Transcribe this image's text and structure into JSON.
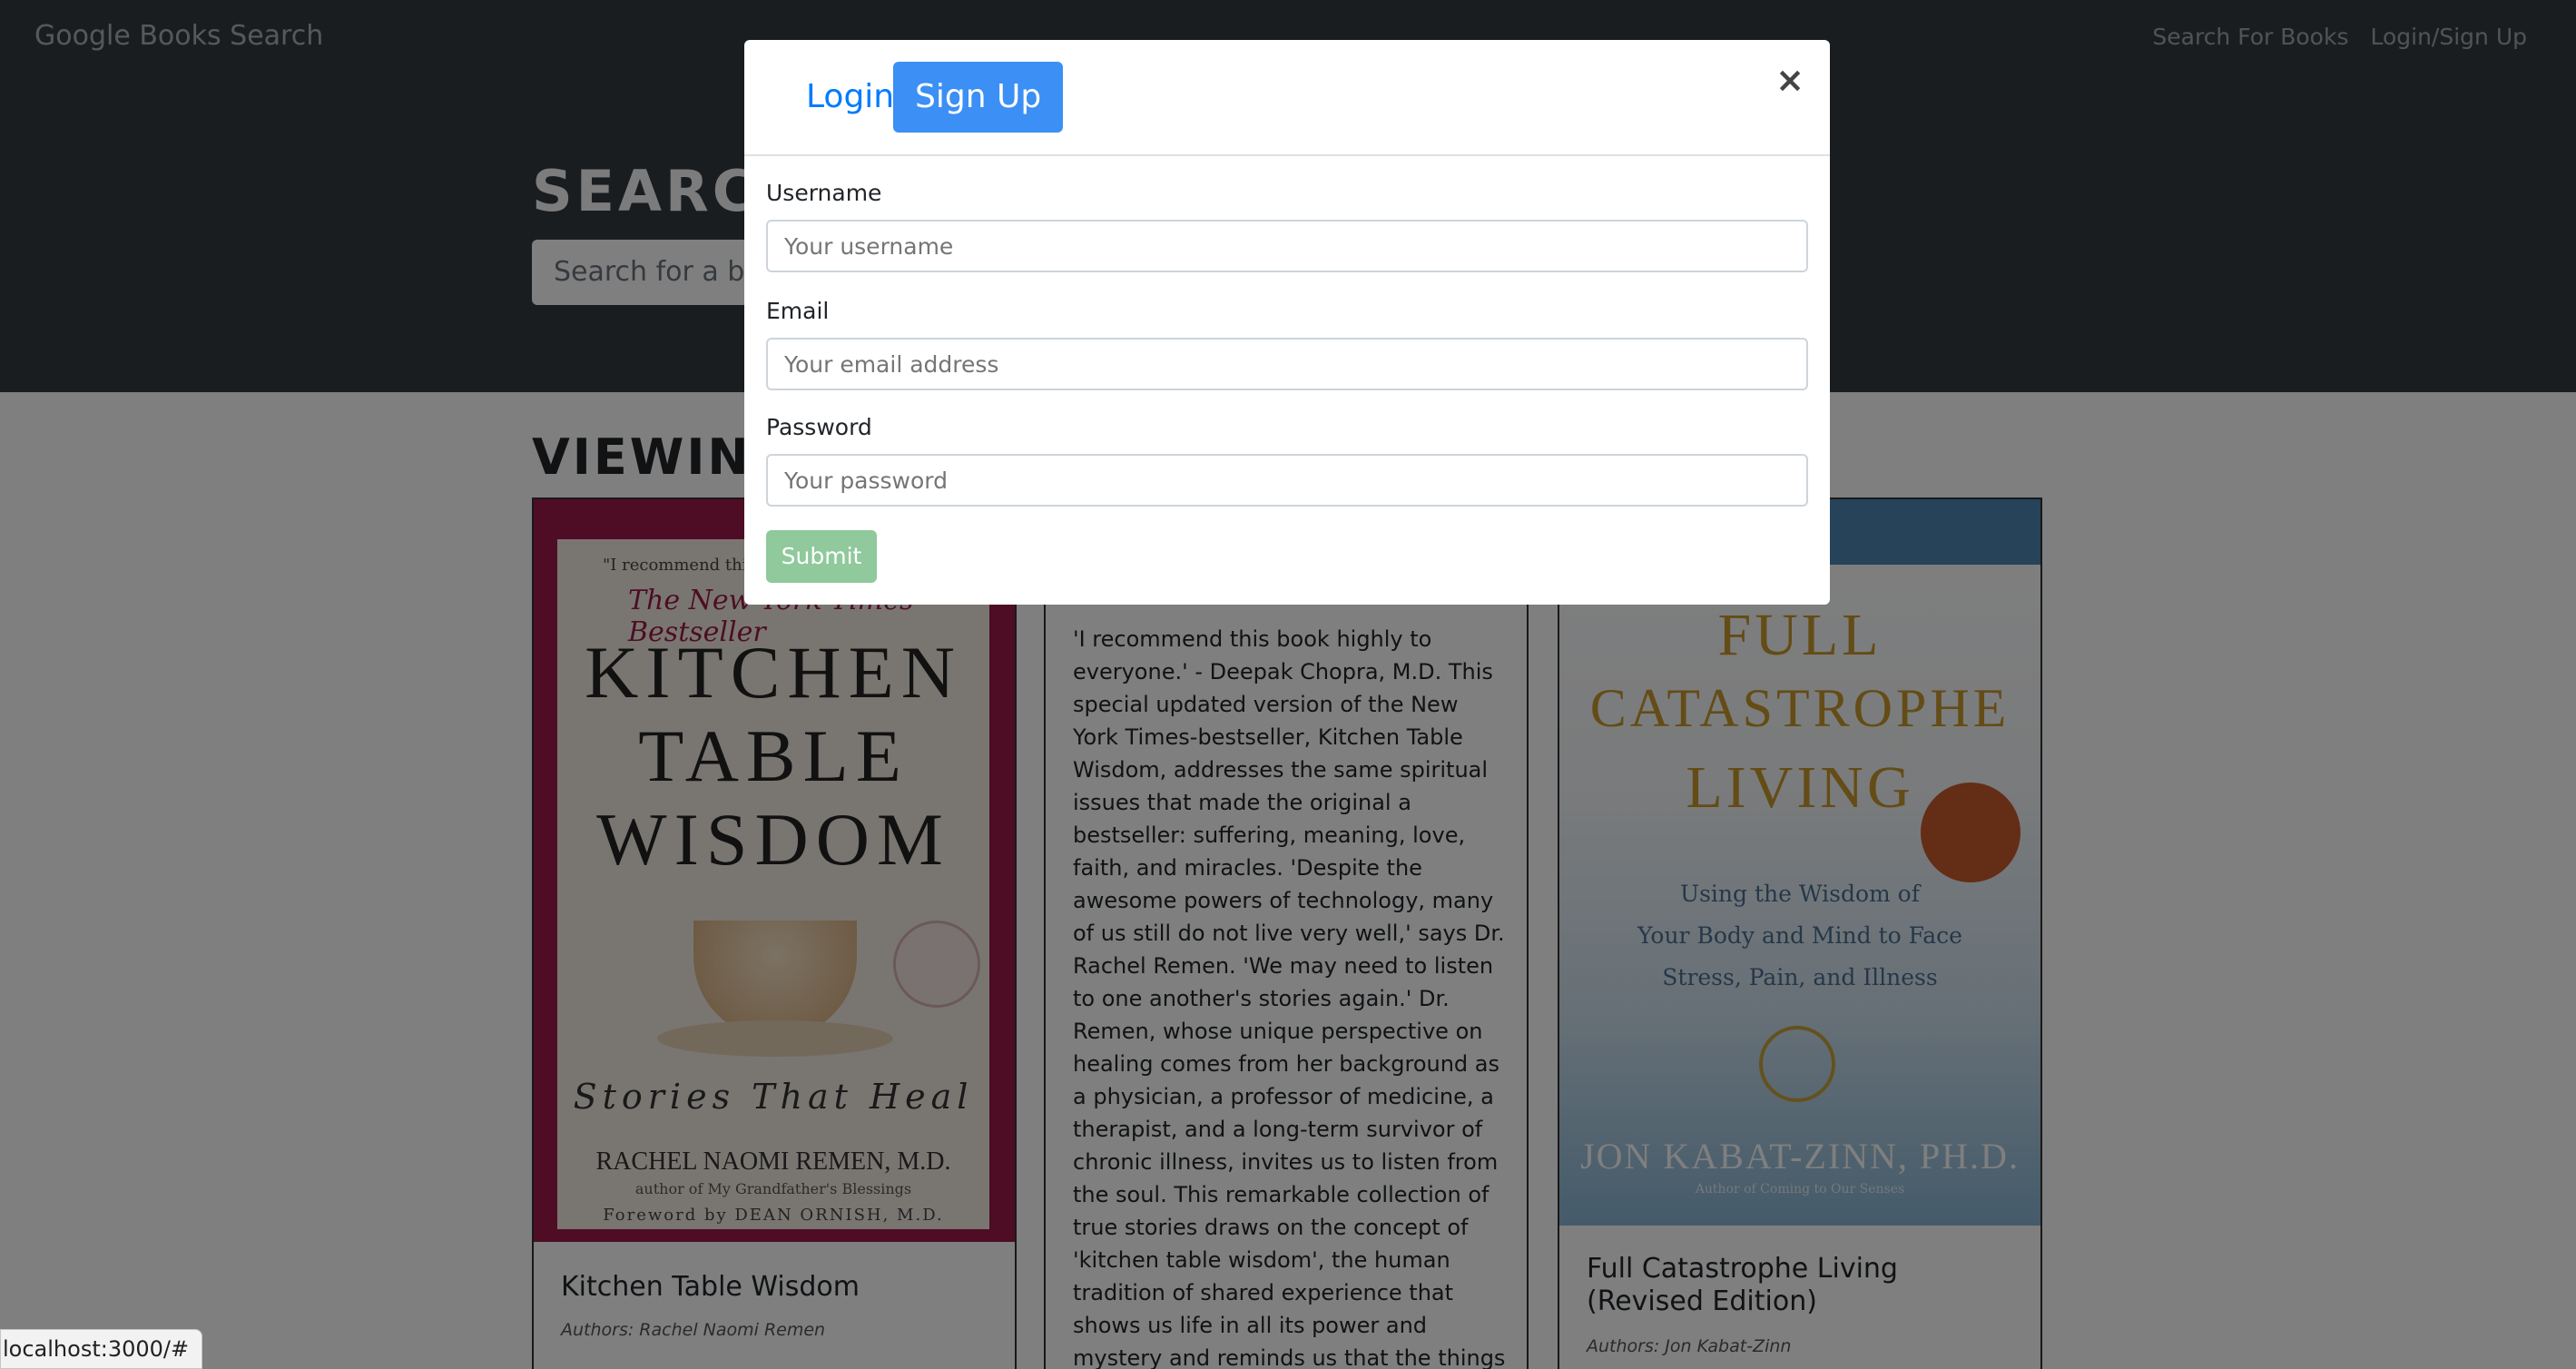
{
  "navbar": {
    "brand": "Google Books Search",
    "links": [
      "Search For Books",
      "Login/Sign Up"
    ]
  },
  "hero": {
    "title": "SEARC",
    "search_placeholder": "Search for a bo"
  },
  "results": {
    "heading": "VIEWIN"
  },
  "books": [
    {
      "title": "Kitchen Table Wisdom",
      "authors": "Authors: Rachel Naomi Remen",
      "cover": {
        "top_quote": "\"I recommend this book highly...\"",
        "banner": "The New York Times Bestseller",
        "lines": [
          "KITCHEN",
          "TABLE",
          "WISDOM"
        ],
        "subtitle": "Stories That Heal",
        "author": "RACHEL NAOMI REMEN, M.D.",
        "author_sub": "author of My Grandfather's Blessings",
        "foreword": "Foreword by DEAN ORNISH, M.D.",
        "color": "#9c1a4a"
      }
    },
    {
      "description": "'I recommend this book highly to everyone.' - Deepak Chopra, M.D. This special updated version of the New York Times-bestseller, Kitchen Table Wisdom, addresses the same spiritual issues that made the original a bestseller: suffering, meaning, love, faith, and miracles. 'Despite the awesome powers of technology, many of us still do not live very well,' says Dr. Rachel Remen. 'We may need to listen to one another's stories again.' Dr. Remen, whose unique perspective on healing comes from her background as a physician, a professor of medicine, a therapist, and a long-term survivor of chronic illness, invites us to listen from the soul. This remarkable collection of true stories draws on the concept of 'kitchen table wisdom', the human tradition of shared experience that shows us life in all its power and mystery and reminds us that the things we cannot measure may be the things"
    },
    {
      "title": "Full Catastrophe Living (Revised Edition)",
      "authors": "Authors: Jon Kabat-Zinn",
      "cover": {
        "lines": [
          "FULL",
          "CATASTROPHE",
          "LIVING"
        ],
        "sub_lines": [
          "Using the Wisdom of",
          "Your Body and Mind to Face",
          "Stress, Pain, and Illness"
        ],
        "author": "JON KABAT-ZINN, PH.D.",
        "author_sub": "Author of Coming to Our Senses",
        "color": "#c8992c"
      }
    }
  ],
  "modal": {
    "tabs": [
      "Login",
      "Sign Up"
    ],
    "active_tab": "Sign Up",
    "close": "×",
    "fields": [
      {
        "label": "Username",
        "placeholder": "Your username"
      },
      {
        "label": "Email",
        "placeholder": "Your email address"
      },
      {
        "label": "Password",
        "placeholder": "Your password"
      }
    ],
    "submit": "Submit"
  },
  "status_bar": "localhost:3000/#",
  "colors": {
    "navbar": "#343a40",
    "primary": "#3b8ff5",
    "submit_disabled": "#8fc99c"
  }
}
